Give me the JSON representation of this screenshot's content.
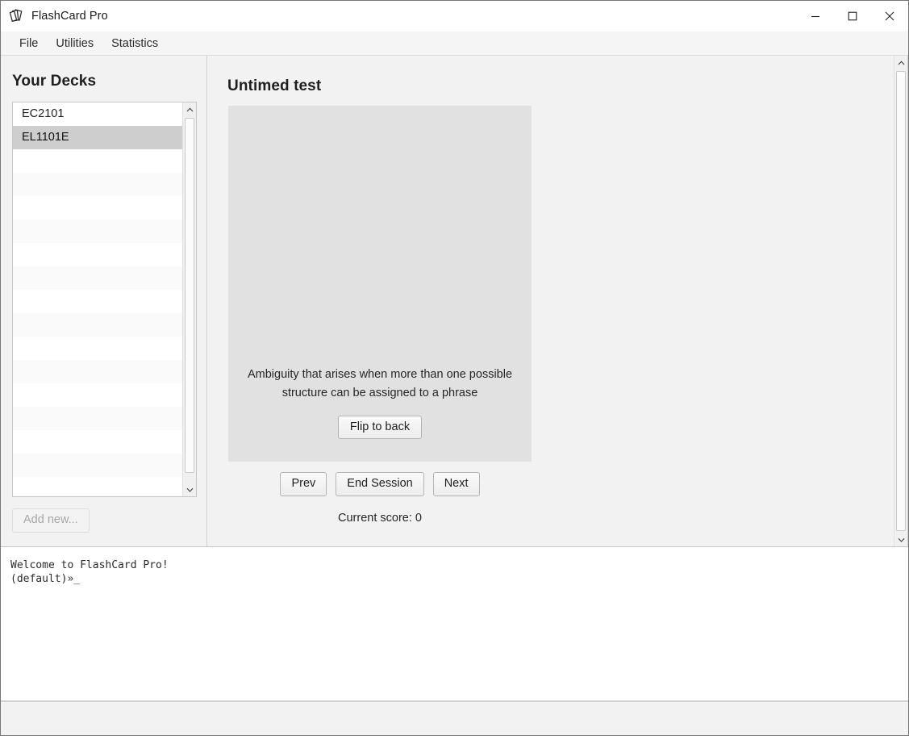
{
  "window": {
    "title": "FlashCard Pro",
    "app_icon": "cards-stack-icon",
    "minimize_label": "Minimize",
    "maximize_label": "Maximize",
    "close_label": "Close"
  },
  "menubar": {
    "items": [
      {
        "label": "File",
        "name": "menu-file"
      },
      {
        "label": "Utilities",
        "name": "menu-utilities"
      },
      {
        "label": "Statistics",
        "name": "menu-statistics"
      }
    ]
  },
  "sidebar": {
    "title": "Your Decks",
    "decks": [
      {
        "label": "EC2101",
        "selected": false
      },
      {
        "label": "EL1101E",
        "selected": true
      }
    ],
    "empty_row_count": 15,
    "add_new_label": "Add new...",
    "add_new_disabled": true
  },
  "main": {
    "section_title": "Untimed test",
    "card": {
      "text": "Ambiguity that arises when more than one possible structure can be assigned to a phrase",
      "flip_label": "Flip to back",
      "background": "#e1e1e1"
    },
    "controls": {
      "prev_label": "Prev",
      "end_session_label": "End Session",
      "next_label": "Next"
    },
    "score_label": "Current score: 0"
  },
  "console": {
    "lines": [
      "Welcome to FlashCard Pro!",
      "(default)»_"
    ]
  },
  "colors": {
    "window_bg": "#f2f2f2",
    "card_bg": "#e1e1e1",
    "selection": "#cecece",
    "text": "#1f1f1f",
    "border": "#c6c6c6"
  }
}
